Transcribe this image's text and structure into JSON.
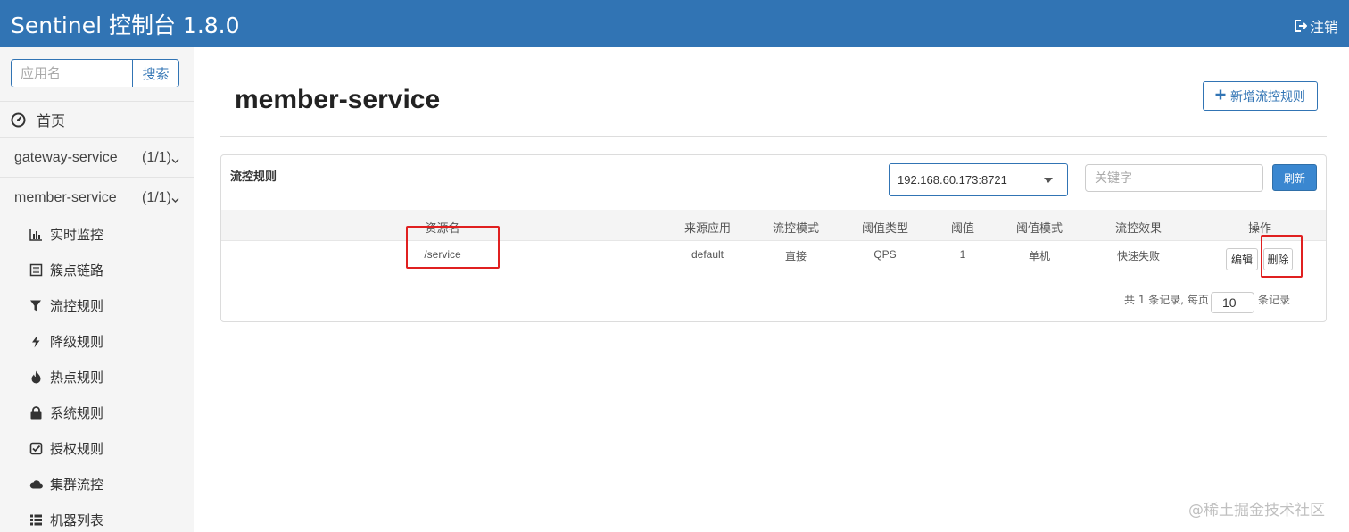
{
  "header": {
    "brand": "Sentinel 控制台 1.8.0",
    "logout_label": "注销",
    "bg_color": "#3174b4"
  },
  "sidebar": {
    "search_placeholder": "应用名",
    "search_button": "搜索",
    "home_label": "首页",
    "apps": [
      {
        "name": "gateway-service",
        "count": "(1/1)"
      },
      {
        "name": "member-service",
        "count": "(1/1)"
      }
    ],
    "sub_items": [
      {
        "label": "实时监控",
        "icon": "bar-chart-icon"
      },
      {
        "label": "簇点链路",
        "icon": "list-icon"
      },
      {
        "label": "流控规则",
        "icon": "filter-icon"
      },
      {
        "label": "降级规则",
        "icon": "flash-icon"
      },
      {
        "label": "热点规则",
        "icon": "fire-icon"
      },
      {
        "label": "系统规则",
        "icon": "lock-icon"
      },
      {
        "label": "授权规则",
        "icon": "check-icon"
      },
      {
        "label": "集群流控",
        "icon": "cloud-icon"
      },
      {
        "label": "机器列表",
        "icon": "th-list-icon"
      }
    ]
  },
  "main": {
    "page_title": "member-service",
    "add_button": "新增流控规则",
    "card_title": "流控规则",
    "machine_selected": "192.168.60.173:8721",
    "keyword_placeholder": "关键字",
    "refresh_button": "刷新",
    "columns": [
      "资源名",
      "来源应用",
      "流控模式",
      "阈值类型",
      "阈值",
      "阈值模式",
      "流控效果",
      "操作"
    ],
    "rows": [
      {
        "resource": "/service",
        "origin": "default",
        "mode": "直接",
        "grade": "QPS",
        "count": "1",
        "cluster_mode": "单机",
        "effect": "快速失败",
        "edit": "编辑",
        "delete": "删除"
      }
    ],
    "pager": {
      "prefix": "共 1 条记录, 每页",
      "page_size": "10",
      "suffix": "条记录"
    }
  },
  "watermark": "@稀土掘金技术社区",
  "accent_color": "#3174b4",
  "highlight_color": "#e02020"
}
